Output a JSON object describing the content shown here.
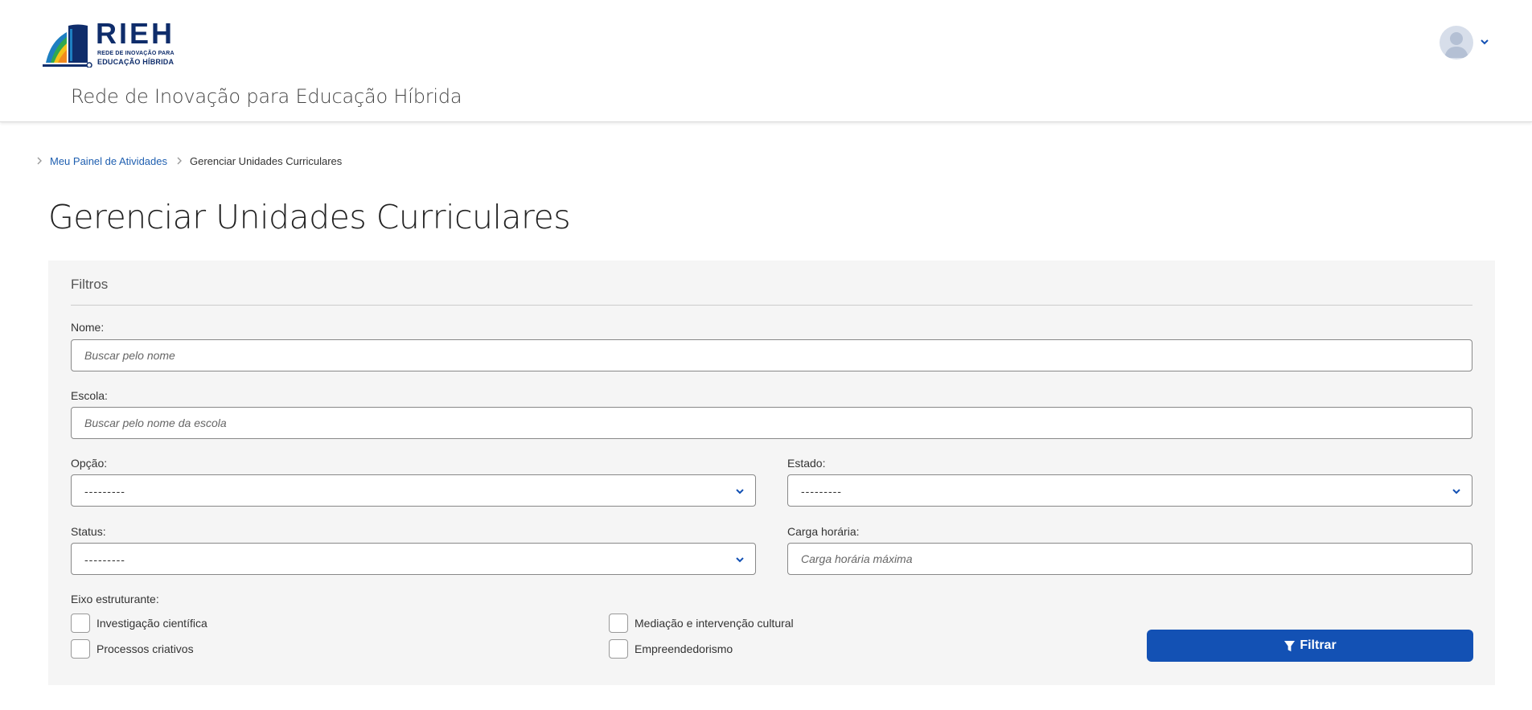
{
  "header": {
    "logo_title": "RIEH",
    "logo_line1": "REDE DE INOVAÇÃO PARA",
    "logo_line2": "EDUCAÇÃO HÍBRIDA",
    "site_name": "Rede de Inovação para Educação Híbrida",
    "user_menu_icon": "chevron-down-icon"
  },
  "breadcrumb": {
    "items": [
      {
        "label": "Meu Painel de Atividades"
      },
      {
        "label": "Gerenciar Unidades Curriculares"
      }
    ]
  },
  "page": {
    "title": "Gerenciar Unidades Curriculares"
  },
  "filters": {
    "title": "Filtros",
    "nome": {
      "label": "Nome:",
      "placeholder": "Buscar pelo nome"
    },
    "escola": {
      "label": "Escola:",
      "placeholder": "Buscar pelo nome da escola"
    },
    "opcao": {
      "label": "Opção:",
      "value": "---------"
    },
    "estado": {
      "label": "Estado:",
      "value": "---------"
    },
    "status": {
      "label": "Status:",
      "value": "---------"
    },
    "carga": {
      "label": "Carga horária:",
      "placeholder": "Carga horária máxima"
    },
    "eixo": {
      "label": "Eixo estruturante:",
      "options": [
        "Investigação científica",
        "Mediação e intervenção cultural",
        "Processos criativos",
        "Empreendedorismo"
      ]
    },
    "submit_label": "Filtrar"
  },
  "colors": {
    "primary": "#1351b4",
    "link": "#1f5fb0",
    "logo": "#0f2d6b",
    "panel_bg": "#f5f5f5"
  }
}
